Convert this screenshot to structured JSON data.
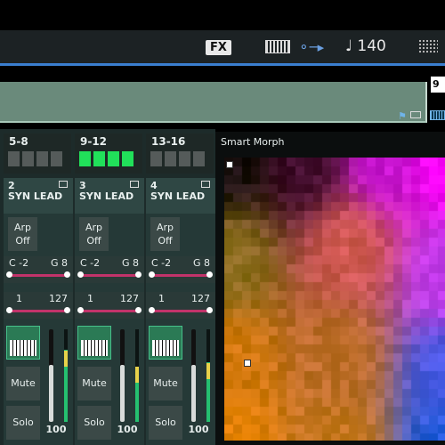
{
  "status": {
    "fx_label": "FX",
    "tempo": "♩ 140",
    "icons": [
      "keyboard-icon",
      "usb-icon",
      "grid-menu-icon"
    ]
  },
  "timeline": {
    "part_badge": "9"
  },
  "page_tabs": [
    {
      "label": "5-8",
      "leds": [
        false,
        false,
        false,
        false
      ]
    },
    {
      "label": "9-12",
      "leds": [
        true,
        true,
        true,
        true
      ]
    },
    {
      "label": "13-16",
      "leds": [
        false,
        false,
        false,
        false
      ]
    }
  ],
  "strips": [
    {
      "num": "2",
      "name": "SYN LEAD",
      "arp": "Arp Off",
      "note_low": "C -2",
      "note_high": "G 8",
      "vel_low": "1",
      "vel_high": "127",
      "mute": "Mute",
      "solo": "Solo",
      "volume": "100",
      "fader_level": 0.62,
      "meter_level": 0.78
    },
    {
      "num": "3",
      "name": "SYN LEAD",
      "arp": "Arp Off",
      "note_low": "C -2",
      "note_high": "G 8",
      "vel_low": "1",
      "vel_high": "127",
      "mute": "Mute",
      "solo": "Solo",
      "volume": "100",
      "fader_level": 0.62,
      "meter_level": 0.6
    },
    {
      "num": "4",
      "name": "SYN LEAD",
      "arp": "Arp Off",
      "note_low": "C -2",
      "note_high": "G 8",
      "vel_low": "1",
      "vel_high": "127",
      "mute": "Mute",
      "solo": "Solo",
      "volume": "100",
      "fader_level": 0.62,
      "meter_level": 0.64
    }
  ],
  "morph": {
    "title": "Smart Morph"
  },
  "colors": {
    "accent_blue": "#3a7ecf",
    "led_on": "#21e05a",
    "range_bar": "#c2336a"
  }
}
